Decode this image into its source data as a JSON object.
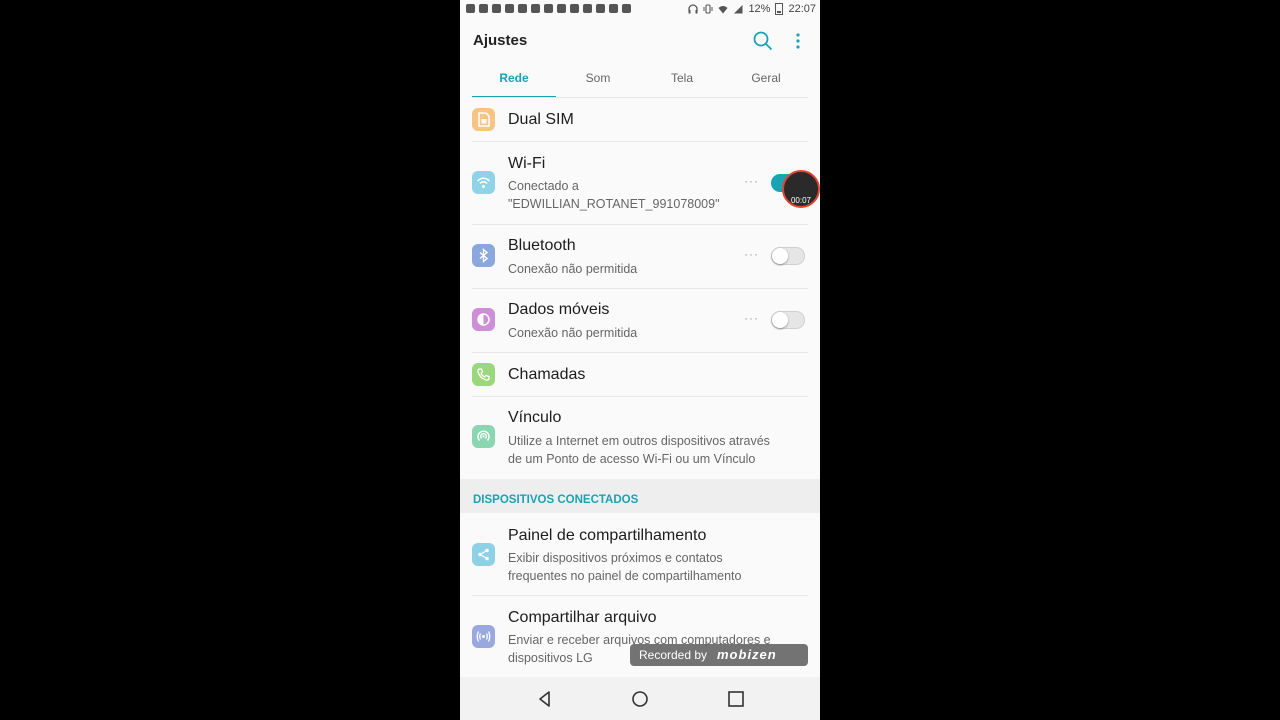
{
  "status_bar": {
    "battery": "12%",
    "time": "22:07"
  },
  "app_bar": {
    "title": "Ajustes"
  },
  "tabs": [
    {
      "label": "Rede",
      "active": true
    },
    {
      "label": "Som",
      "active": false
    },
    {
      "label": "Tela",
      "active": false
    },
    {
      "label": "Geral",
      "active": false
    }
  ],
  "rows": {
    "dual_sim": {
      "title": "Dual SIM",
      "icon": "sim-card-icon",
      "icon_color": "#f6c483"
    },
    "wifi": {
      "title": "Wi-Fi",
      "sub1": "Conectado a",
      "sub2": "\"EDWILLIAN_ROTANET_991078009\"",
      "icon": "wifi-icon",
      "icon_color": "#8fd3e8",
      "more": "···",
      "toggle_on": true
    },
    "bluetooth": {
      "title": "Bluetooth",
      "sub": "Conexão não permitida",
      "icon": "bluetooth-icon",
      "icon_color": "#8aa7de",
      "more": "···",
      "toggle_on": false
    },
    "mobile_data": {
      "title": "Dados móveis",
      "sub": "Conexão não permitida",
      "icon": "mobile-data-icon",
      "icon_color": "#cf8fd8",
      "more": "···",
      "toggle_on": false
    },
    "calls": {
      "title": "Chamadas",
      "icon": "phone-icon",
      "icon_color": "#9bd77c"
    },
    "tethering": {
      "title": "Vínculo",
      "sub1": "Utilize a Internet em outros dispositivos através",
      "sub2": "de um Ponto de acesso Wi-Fi ou um Vínculo",
      "icon": "hotspot-icon",
      "icon_color": "#8ad6b0"
    }
  },
  "section": {
    "label": "DISPOSITIVOS CONECTADOS"
  },
  "connected_rows": {
    "share_panel": {
      "title": "Painel de compartilhamento",
      "sub1": "Exibir dispositivos próximos e contatos",
      "sub2": "frequentes no painel de compartilhamento",
      "icon": "share-icon",
      "icon_color": "#8ed0e6"
    },
    "file_share": {
      "title": "Compartilhar arquivo",
      "sub1": "Enviar e receber arquivos com computadores e",
      "sub2": "dispositivos LG",
      "icon": "file-share-icon",
      "icon_color": "#9aa8e0"
    }
  },
  "recording": {
    "time": "00:07",
    "badge_text": "Recorded by",
    "badge_logo": "mobizen"
  },
  "colors": {
    "accent": "#1aa3b4"
  }
}
